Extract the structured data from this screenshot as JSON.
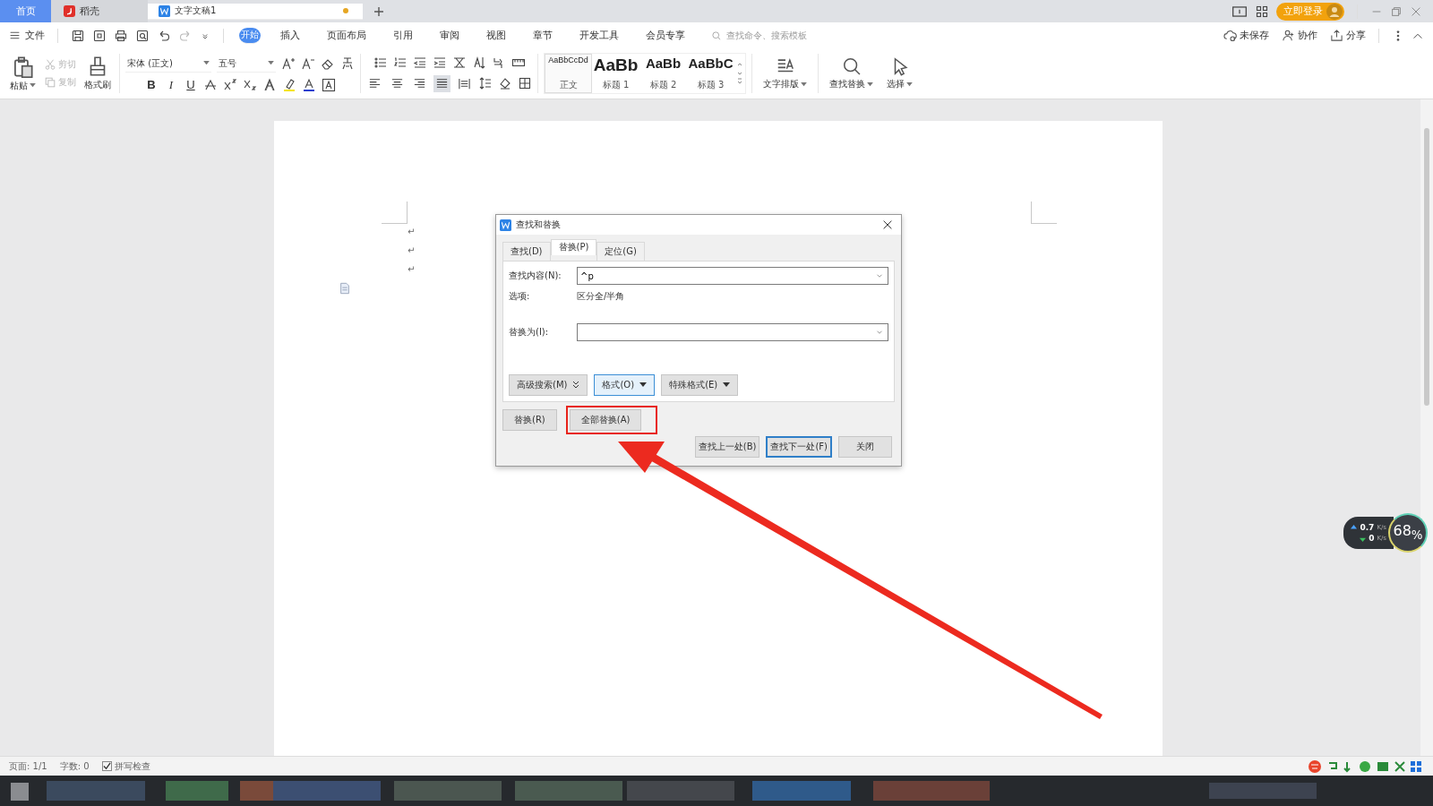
{
  "tabs": [
    {
      "label": "首页",
      "kind": "home",
      "selected": false
    },
    {
      "label": "稻壳",
      "kind": "store",
      "selected": false
    },
    {
      "label": "文字文稿1",
      "kind": "doc",
      "selected": true,
      "unsaved": true
    }
  ],
  "title_bar": {
    "login_button": "立即登录"
  },
  "menu": {
    "file": "文件",
    "tabs": [
      {
        "label": "开始",
        "selected": true
      },
      {
        "label": "插入",
        "selected": false
      },
      {
        "label": "页面布局",
        "selected": false
      },
      {
        "label": "引用",
        "selected": false
      },
      {
        "label": "审阅",
        "selected": false
      },
      {
        "label": "视图",
        "selected": false
      },
      {
        "label": "章节",
        "selected": false
      },
      {
        "label": "开发工具",
        "selected": false
      },
      {
        "label": "会员专享",
        "selected": false
      }
    ],
    "search": {
      "placeholder": "查找命令、搜索模板"
    },
    "actions": [
      {
        "label": "未保存",
        "kind": "cloud"
      },
      {
        "label": "协作",
        "kind": "user"
      },
      {
        "label": "分享",
        "kind": "share"
      }
    ]
  },
  "ribbon": {
    "paste": "粘贴",
    "clipboard": [
      {
        "label": "剪切",
        "kind": "cut",
        "disabled": true
      },
      {
        "label": "复制",
        "kind": "copy",
        "disabled": true
      }
    ],
    "format_painter": "格式刷",
    "font": "宋体 (正文)",
    "size": "五号",
    "format_buttons": [
      "B",
      "I",
      "U"
    ],
    "alignments": [
      {
        "selected": false
      },
      {
        "selected": false
      },
      {
        "selected": false
      },
      {
        "selected": true
      },
      {
        "selected": false
      }
    ],
    "styles": [
      {
        "preview": "AaBbCcDd",
        "label": "正文",
        "kind": "body",
        "selected": true
      },
      {
        "preview": "AaBb",
        "label": "标题 1",
        "kind": "h1",
        "selected": false
      },
      {
        "preview": "AaBb",
        "label": "标题 2",
        "kind": "h2",
        "selected": false
      },
      {
        "preview": "AaBbC",
        "label": "标题 3",
        "kind": "h3",
        "selected": false
      }
    ],
    "typesetting": "文字排版",
    "find_replace": "查找替换",
    "select": "选择"
  },
  "document": {
    "paragraph_marks": [
      "↵",
      "↵",
      "↵"
    ]
  },
  "dialog": {
    "title": "查找和替换",
    "tabs": [
      {
        "label": "查找(D)",
        "selected": false
      },
      {
        "label": "替换(P)",
        "selected": true
      },
      {
        "label": "定位(G)",
        "selected": false
      }
    ],
    "find_label": "查找内容(N):",
    "find_value": "^p",
    "options_label": "选项:",
    "options_value": "区分全/半角",
    "replace_label": "替换为(I):",
    "option_buttons": [
      {
        "label": "高级搜索(M)",
        "kind": "expand",
        "focused": false
      },
      {
        "label": "格式(O)",
        "kind": "dropdown",
        "focused": true
      },
      {
        "label": "特殊格式(E)",
        "kind": "dropdown",
        "focused": false
      }
    ],
    "replace_buttons": [
      {
        "label": "替换(R)",
        "highlighted": false
      },
      {
        "label": "全部替换(A)",
        "highlighted": true
      }
    ],
    "nav_buttons": [
      {
        "label": "查找上一处(B)",
        "default": false
      },
      {
        "label": "查找下一处(F)",
        "default": true
      },
      {
        "label": "关闭",
        "default": false
      }
    ]
  },
  "network_widget": {
    "upload": "0.7",
    "upload_unit": "K/s",
    "download": "0",
    "download_unit": "K/s",
    "percent": "68$_{%}$"
  },
  "status_bar": {
    "page": "页面: 1/1",
    "words": "字数: 0",
    "spell_check": {
      "label": "拼写检查",
      "checked": true
    }
  }
}
